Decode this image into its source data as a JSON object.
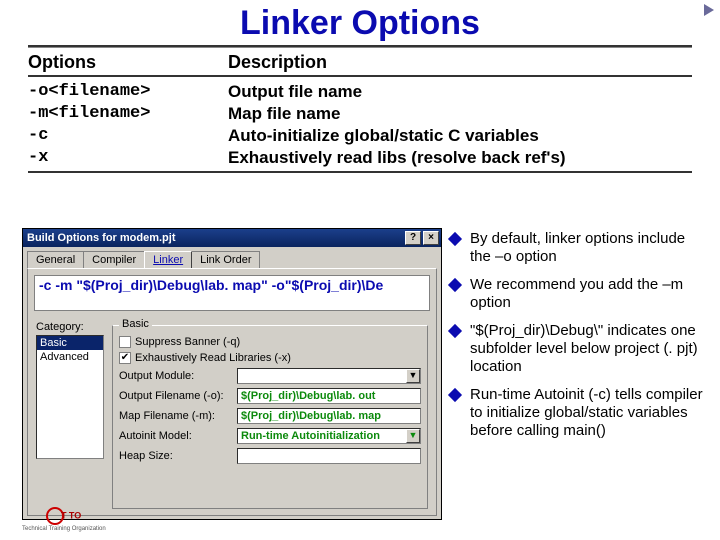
{
  "title": "Linker Options",
  "nav_arrow": "next-slide",
  "table": {
    "head": {
      "col1": "Options",
      "col2": "Description"
    },
    "rows": [
      {
        "opt": "-o<filename>",
        "desc": "Output file name"
      },
      {
        "opt": "-m<filename>",
        "desc": "Map file name"
      },
      {
        "opt": "-c",
        "desc": "Auto-initialize global/static C variables"
      },
      {
        "opt": "-x",
        "desc": "Exhaustively read libs (resolve back ref's)"
      }
    ]
  },
  "dialog": {
    "title": "Build Options for modem.pjt",
    "help_btn": "?",
    "close_btn": "×",
    "tabs": [
      "General",
      "Compiler",
      "Linker",
      "Link Order"
    ],
    "active_tab": 2,
    "cmdline_prefix": "-c -m \"$(Proj_dir)\\Debug\\lab. map\" ",
    "cmdline_suffix": "-o\"$(Proj_dir)\\De",
    "category_label": "Category:",
    "categories": [
      "Basic",
      "Advanced"
    ],
    "selected_category": 0,
    "group_title": "Basic",
    "suppress": {
      "label": "Suppress Banner (-q)",
      "checked": false
    },
    "exhaustive": {
      "label": "Exhaustively Read Libraries (-x)",
      "checked": true
    },
    "output_module": {
      "label": "Output Module:",
      "value": ""
    },
    "output_filename": {
      "label": "Output Filename (-o):",
      "value": "$(Proj_dir)\\Debug\\lab. out"
    },
    "map_filename": {
      "label": "Map Filename (-m):",
      "value": "$(Proj_dir)\\Debug\\lab. map"
    },
    "autoinit": {
      "label": "Autoinit Model:",
      "value": "Run-time Autoinitialization"
    },
    "heap": {
      "label": "Heap Size:",
      "value": ""
    }
  },
  "bullets": [
    "By default, linker options include the –o option",
    "We recommend you add the –m option",
    "\"$(Proj_dir)\\Debug\\\" indicates one subfolder level below project (. pjt) location",
    "Run-time Autoinit (-c) tells compiler to initialize global/static variables before calling main()"
  ],
  "logo": {
    "text": "T TO",
    "sub": "Technical Training Organization"
  }
}
